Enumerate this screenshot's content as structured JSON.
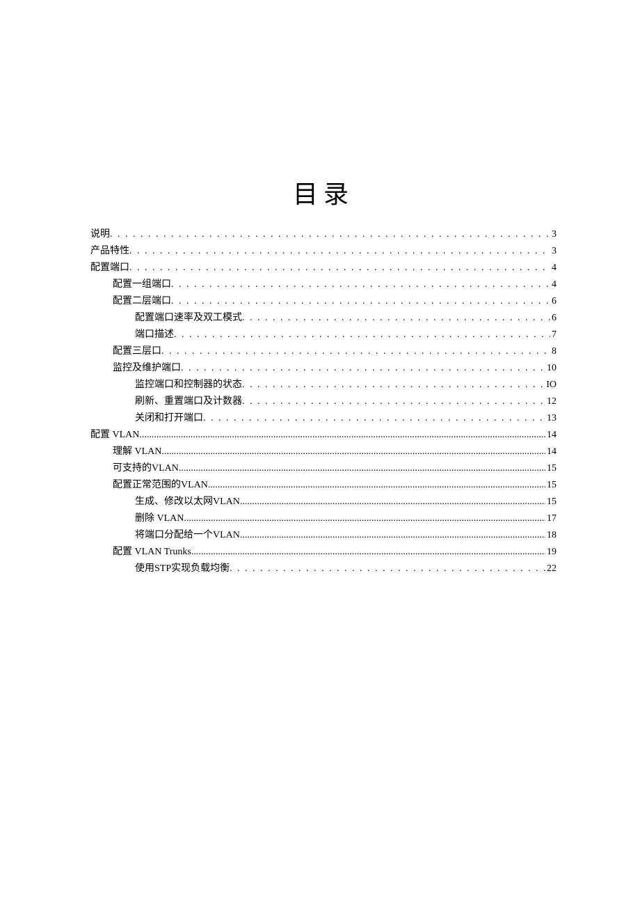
{
  "title": "目录",
  "entries": [
    {
      "level": 0,
      "label": "说明",
      "page": "3",
      "leader": "sparse"
    },
    {
      "level": 0,
      "label": "产品特性",
      "page": "3",
      "leader": "sparse"
    },
    {
      "level": 0,
      "label": "配置端口",
      "page": "4",
      "leader": "sparse"
    },
    {
      "level": 1,
      "label": "配置一组端口",
      "page": "4",
      "leader": "sparse"
    },
    {
      "level": 1,
      "label": "配置二层端口",
      "page": "6",
      "leader": "sparse"
    },
    {
      "level": 2,
      "label": "配置端口速率及双工模式",
      "page": "6",
      "leader": "sparse"
    },
    {
      "level": 2,
      "label": "端口描述",
      "page": "7",
      "leader": "sparse"
    },
    {
      "level": 1,
      "label": "配置三层口",
      "page": "8",
      "leader": "sparse"
    },
    {
      "level": 1,
      "label": "监控及维护端口",
      "page": "10",
      "leader": "sparse"
    },
    {
      "level": 2,
      "label": "监控端口和控制器的状态",
      "page": "IO",
      "leader": "sparse"
    },
    {
      "level": 2,
      "label": "刷新、重置端口及计数器",
      "page": "12",
      "leader": "sparse"
    },
    {
      "level": 2,
      "label": "关闭和打开端口",
      "page": "13",
      "leader": "sparse"
    },
    {
      "level": 0,
      "label": "配置  VLAN",
      "page": "14",
      "leader": "dense"
    },
    {
      "level": 1,
      "label": "理解  VLAN",
      "page": "14",
      "leader": "dense"
    },
    {
      "level": 1,
      "label": "可支持的VLAN",
      "page": "15",
      "leader": "dense"
    },
    {
      "level": 1,
      "label": "配置正常范围的VLAN",
      "page": "15",
      "leader": "dense"
    },
    {
      "level": 2,
      "label": "生成、修改以太网VLAN",
      "page": "15",
      "leader": "dense"
    },
    {
      "level": 2,
      "label": "删除  VLAN",
      "page": " 17",
      "leader": "dense"
    },
    {
      "level": 2,
      "label": "将端口分配给一个VLAN",
      "page": " 18",
      "leader": "dense"
    },
    {
      "level": 1,
      "label": "配置  VLAN Trunks",
      "page": "19",
      "leader": "dense"
    },
    {
      "level": 2,
      "label": "使用STP实现负载均衡",
      "page": "22",
      "leader": "sparse"
    }
  ]
}
